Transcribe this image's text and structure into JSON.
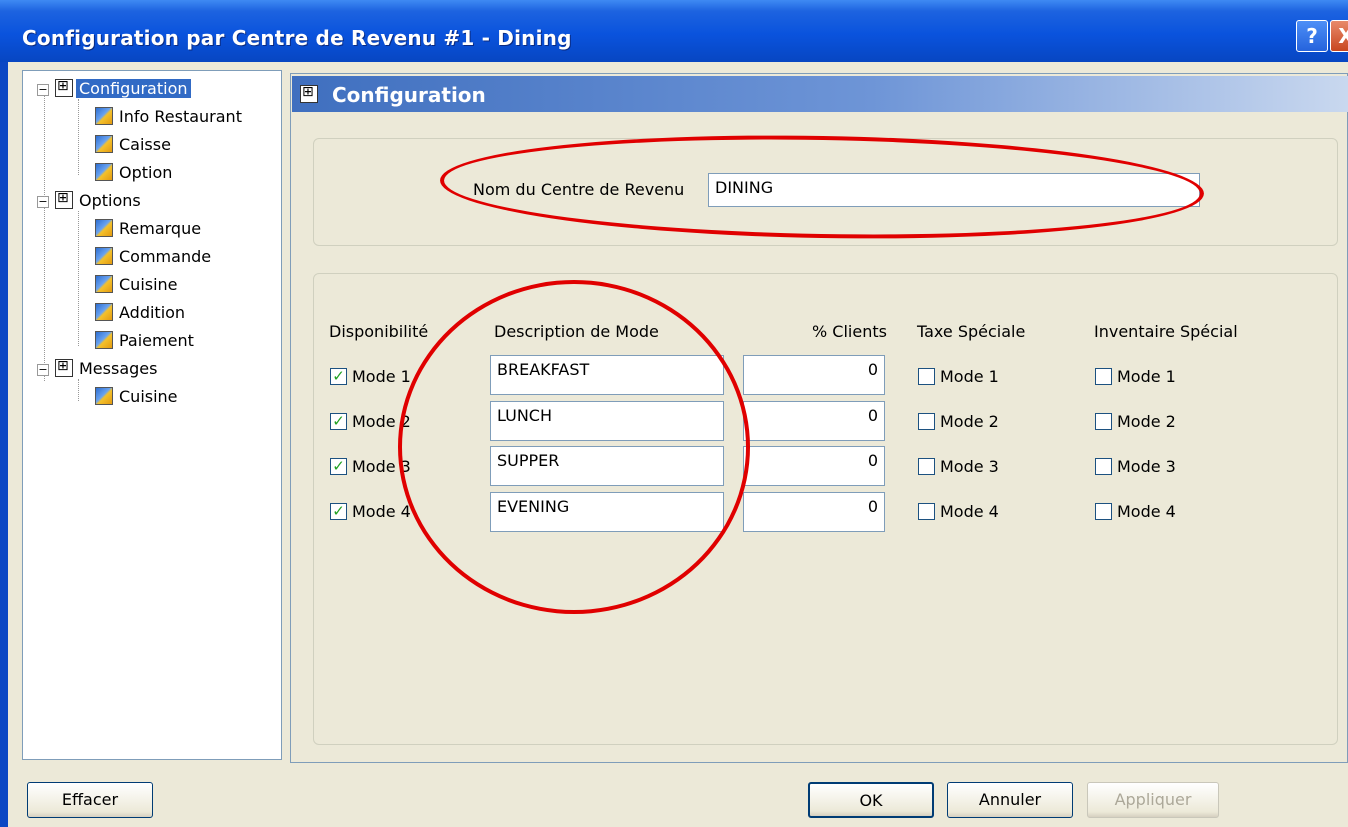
{
  "window": {
    "title": "Configuration par Centre de Revenu #1 - Dining",
    "help_label": "?",
    "close_label": "X"
  },
  "tree": {
    "items": [
      {
        "label": "Configuration",
        "level": 0,
        "icon": "folder-icon",
        "expander": "−",
        "selected": true
      },
      {
        "label": "Info Restaurant",
        "level": 1,
        "icon": "gear-icon"
      },
      {
        "label": "Caisse",
        "level": 1,
        "icon": "gear-icon"
      },
      {
        "label": "Option",
        "level": 1,
        "icon": "gear-icon"
      },
      {
        "label": "Options",
        "level": 0,
        "icon": "folder-icon",
        "expander": "−"
      },
      {
        "label": "Remarque",
        "level": 1,
        "icon": "gear-icon"
      },
      {
        "label": "Commande",
        "level": 1,
        "icon": "gear-icon"
      },
      {
        "label": "Cuisine",
        "level": 1,
        "icon": "gear-icon"
      },
      {
        "label": "Addition",
        "level": 1,
        "icon": "gear-icon"
      },
      {
        "label": "Paiement",
        "level": 1,
        "icon": "gear-icon"
      },
      {
        "label": "Messages",
        "level": 0,
        "icon": "folder-icon",
        "expander": "−"
      },
      {
        "label": "Cuisine",
        "level": 1,
        "icon": "gear-icon"
      }
    ]
  },
  "header": {
    "title": "Configuration"
  },
  "name_section": {
    "label": "Nom du Centre de Revenu",
    "value": "DINING"
  },
  "modes_section": {
    "col_availability": "Disponibilité",
    "col_description": "Description de Mode",
    "col_clients": "% Clients",
    "col_tax": "Taxe Spéciale",
    "col_inventory": "Inventaire Spécial",
    "rows": [
      {
        "mode_label": "Mode 1",
        "available": true,
        "description": "BREAKFAST",
        "clients": "0",
        "tax_label": "Mode 1",
        "tax": false,
        "inv_label": "Mode 1",
        "inv": false
      },
      {
        "mode_label": "Mode 2",
        "available": true,
        "description": "LUNCH",
        "clients": "0",
        "tax_label": "Mode 2",
        "tax": false,
        "inv_label": "Mode 2",
        "inv": false
      },
      {
        "mode_label": "Mode 3",
        "available": true,
        "description": "SUPPER",
        "clients": "0",
        "tax_label": "Mode 3",
        "tax": false,
        "inv_label": "Mode 3",
        "inv": false
      },
      {
        "mode_label": "Mode 4",
        "available": true,
        "description": "EVENING",
        "clients": "0",
        "tax_label": "Mode 4",
        "tax": false,
        "inv_label": "Mode 4",
        "inv": false
      }
    ]
  },
  "buttons": {
    "clear": "Effacer",
    "ok": "OK",
    "cancel": "Annuler",
    "apply": "Appliquer"
  },
  "colors": {
    "titlebar": "#0a53dd",
    "annotation": "#e00000",
    "selection": "#316ac5",
    "checkmark": "#21a121"
  }
}
